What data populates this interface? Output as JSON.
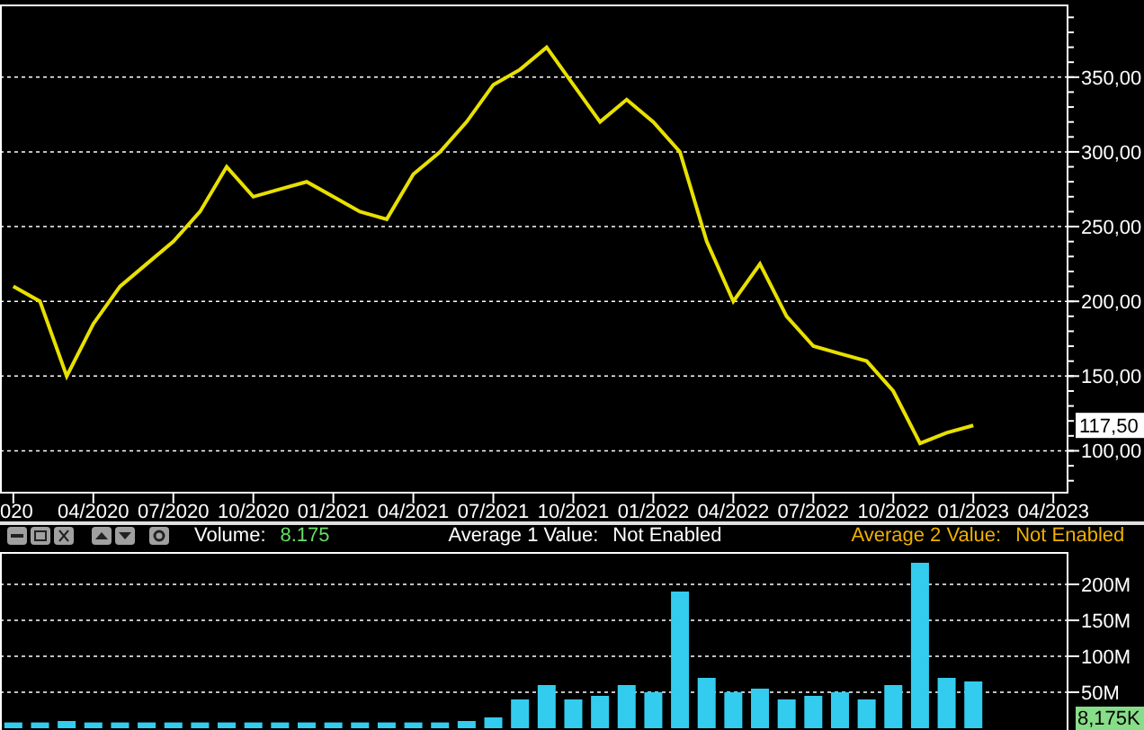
{
  "price_chart": {
    "chart_data": {
      "type": "line",
      "grid": true,
      "categories": [
        "020",
        null,
        null,
        "04/2020",
        null,
        null,
        "07/2020",
        null,
        null,
        "10/2020",
        null,
        null,
        "01/2021",
        null,
        null,
        "04/2021",
        null,
        null,
        "07/2021",
        null,
        null,
        "10/2021",
        null,
        null,
        "01/2022",
        null,
        null,
        "04/2022",
        null,
        null,
        "07/2022",
        null,
        null,
        "10/2022",
        null,
        null,
        "01/2023",
        null,
        null,
        "04/2023"
      ],
      "series": [
        {
          "color": "#e8e000",
          "values": [
            210,
            200,
            150,
            185,
            210,
            225,
            240,
            260,
            290,
            270,
            275,
            280,
            270,
            260,
            255,
            285,
            300,
            320,
            345,
            355,
            370,
            345,
            320,
            335,
            320,
            300,
            240,
            200,
            225,
            190,
            170,
            165,
            160,
            140,
            105,
            112,
            117,
            null,
            null,
            null
          ]
        }
      ],
      "ylim": [
        72,
        398
      ],
      "yticks": [
        {
          "value": 100,
          "label": "100,00"
        },
        {
          "value": 150,
          "label": "150,00"
        },
        {
          "value": 200,
          "label": "200,00"
        },
        {
          "value": 250,
          "label": "250,00"
        },
        {
          "value": 300,
          "label": "300,00"
        },
        {
          "value": 350,
          "label": "350,00"
        }
      ]
    },
    "last_price_label": "117,50"
  },
  "toolbar": {
    "volume_label": "Volume:",
    "volume_value": "8.175",
    "average_1": {
      "label": "Average 1 Value:",
      "value": "Not Enabled"
    },
    "average_2": {
      "label": "Average 2 Value:",
      "value": "Not Enabled"
    }
  },
  "volume_chart": {
    "chart_data": {
      "type": "bar",
      "grid": true,
      "categories": [
        null,
        null,
        null,
        null,
        null,
        null,
        null,
        null,
        null,
        null,
        null,
        null,
        null,
        null,
        null,
        null,
        null,
        null,
        null,
        null,
        null,
        null,
        null,
        null,
        null,
        null,
        null,
        null,
        null,
        null,
        null,
        null,
        null,
        null,
        null,
        null,
        null,
        null,
        null,
        null
      ],
      "series": [
        {
          "color": "#33ccee",
          "values": [
            8,
            8,
            10,
            8,
            8,
            8,
            8,
            8,
            8,
            8,
            8,
            8,
            8,
            8,
            8,
            8,
            8,
            10,
            15,
            40,
            60,
            40,
            45,
            60,
            50,
            190,
            70,
            50,
            55,
            40,
            45,
            50,
            40,
            60,
            230,
            70,
            65,
            null,
            null,
            null
          ]
        }
      ],
      "ylim": [
        0,
        245
      ],
      "yticks": [
        {
          "value": 50,
          "label": "50M"
        },
        {
          "value": 100,
          "label": "100M"
        },
        {
          "value": 150,
          "label": "150M"
        },
        {
          "value": 200,
          "label": "200M"
        }
      ]
    },
    "last_volume_label": "8,175K"
  }
}
